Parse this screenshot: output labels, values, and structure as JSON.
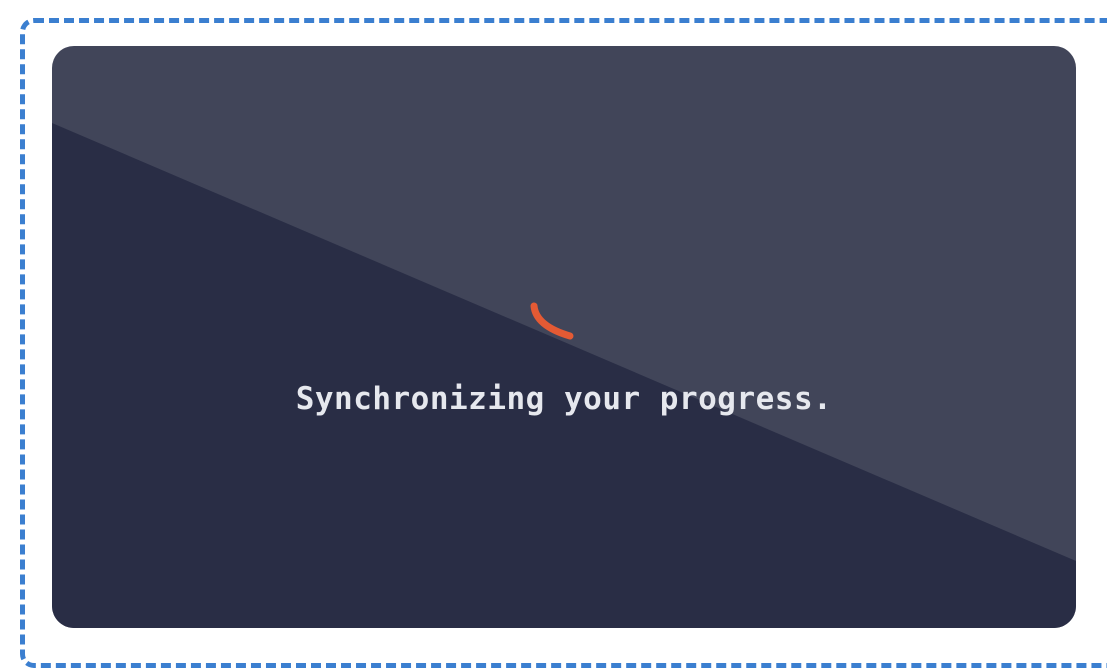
{
  "loader": {
    "message": "Synchronizing your progress.",
    "spinner_icon": "loading-spinner-icon"
  },
  "colors": {
    "panel_light": "#414559",
    "panel_dark": "#292d45",
    "spinner": "#e45a34",
    "text": "#e6e8ee",
    "frame_border": "#3b7fd0"
  }
}
